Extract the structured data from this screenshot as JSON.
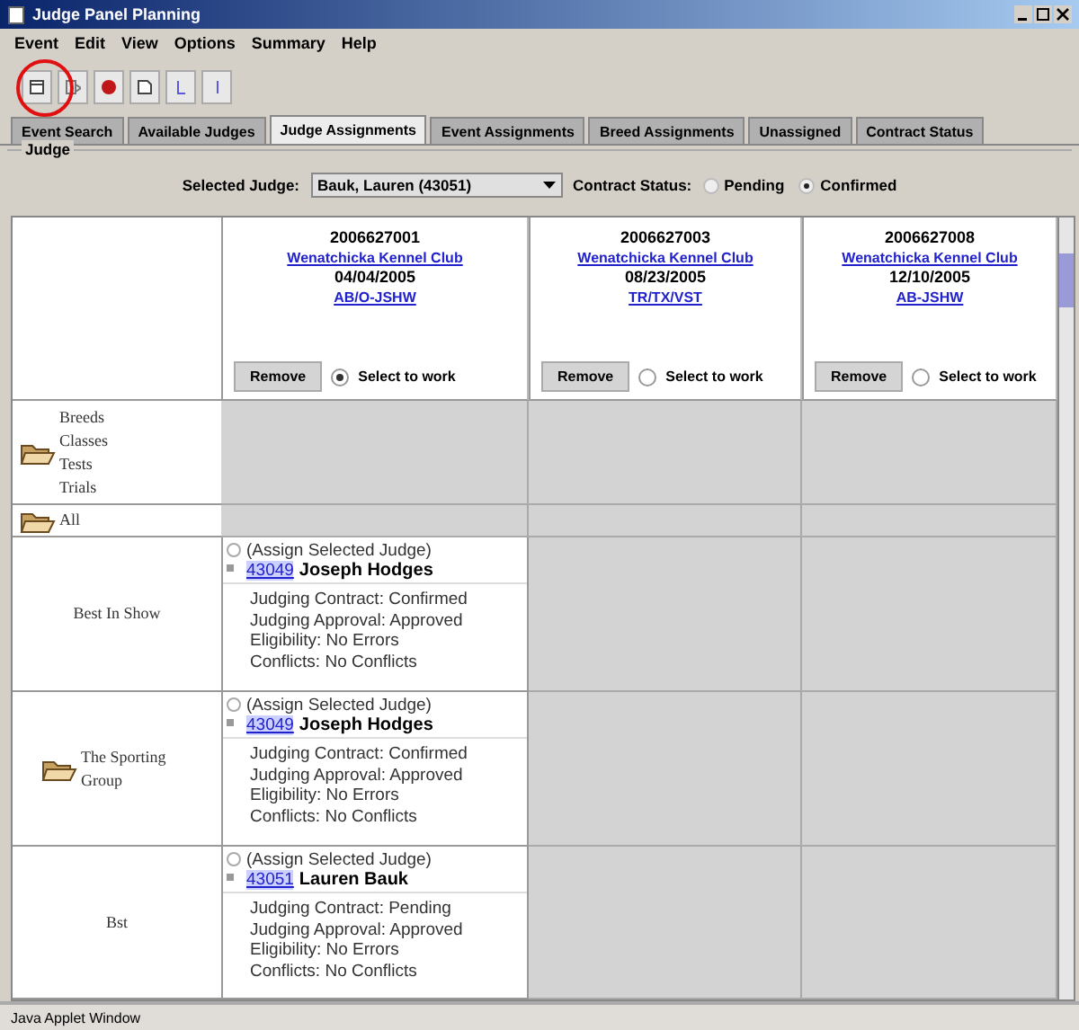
{
  "window": {
    "title": "Judge Panel Planning"
  },
  "menu": [
    "Event",
    "Edit",
    "View",
    "Options",
    "Summary",
    "Help"
  ],
  "tabs": [
    {
      "label": "Event Search",
      "selected": false
    },
    {
      "label": "Available Judges",
      "selected": false
    },
    {
      "label": "Judge Assignments",
      "selected": true
    },
    {
      "label": "Event Assignments",
      "selected": false
    },
    {
      "label": "Breed Assignments",
      "selected": false
    },
    {
      "label": "Unassigned",
      "selected": false
    },
    {
      "label": "Contract Status",
      "selected": false
    }
  ],
  "judge_panel": {
    "title": "Judge",
    "selected_judge_label": "Selected Judge:",
    "selected_judge": "Bauk, Lauren (43051)",
    "contract_status_label": "Contract Status:",
    "options": [
      {
        "label": "Pending",
        "selected": false
      },
      {
        "label": "Confirmed",
        "selected": true
      }
    ]
  },
  "events": [
    {
      "number": "2006627001",
      "club": "Wenatchicka Kennel Club",
      "date": "04/04/2005",
      "classes": "AB/O-JSHW",
      "remove": "Remove",
      "select_label": "Select to work",
      "selected": true
    },
    {
      "number": "2006627003",
      "club": "Wenatchicka Kennel Club",
      "date": "08/23/2005",
      "classes": "TR/TX/VST",
      "remove": "Remove",
      "select_label": "Select to work",
      "selected": false
    },
    {
      "number": "2006627008",
      "club": "Wenatchicka Kennel Club",
      "date": "12/10/2005",
      "classes": "AB-JSHW",
      "remove": "Remove",
      "select_label": "Select to work",
      "selected": false
    }
  ],
  "rows": [
    {
      "kind": "category",
      "labels": [
        "Breeds",
        "Classes",
        "Tests",
        "Trials"
      ]
    },
    {
      "kind": "category",
      "labels": [
        "All"
      ]
    },
    {
      "kind": "item",
      "folder": false,
      "labels": [
        "Best In Show"
      ],
      "assignment": {
        "action": "(Assign Selected Judge)",
        "judge_id": "43049",
        "judge_name": "Joseph Hodges",
        "selected": false,
        "details": [
          "Judging Contract: Confirmed",
          "Judging Approval: Approved",
          "Eligibility: No Errors",
          "Conflicts: No Conflicts"
        ]
      }
    },
    {
      "kind": "item",
      "folder": true,
      "labels": [
        "The Sporting Group"
      ],
      "assignment": {
        "action": "(Assign Selected Judge)",
        "judge_id": "43049",
        "judge_name": "Joseph Hodges",
        "selected": false,
        "details": [
          "Judging Contract: Confirmed",
          "Judging Approval: Approved",
          "Eligibility: No Errors",
          "Conflicts: No Conflicts"
        ]
      }
    },
    {
      "kind": "item",
      "folder": false,
      "labels": [
        "Bst"
      ],
      "assignment": {
        "action": "(Assign Selected Judge)",
        "judge_id": "43051",
        "judge_name": "Lauren Bauk",
        "selected": false,
        "details": [
          "Judging Contract: Pending",
          "Judging Approval: Approved",
          "Eligibility: No Errors",
          "Conflicts: No Conflicts"
        ]
      }
    }
  ],
  "status_bar": "Java Applet Window"
}
